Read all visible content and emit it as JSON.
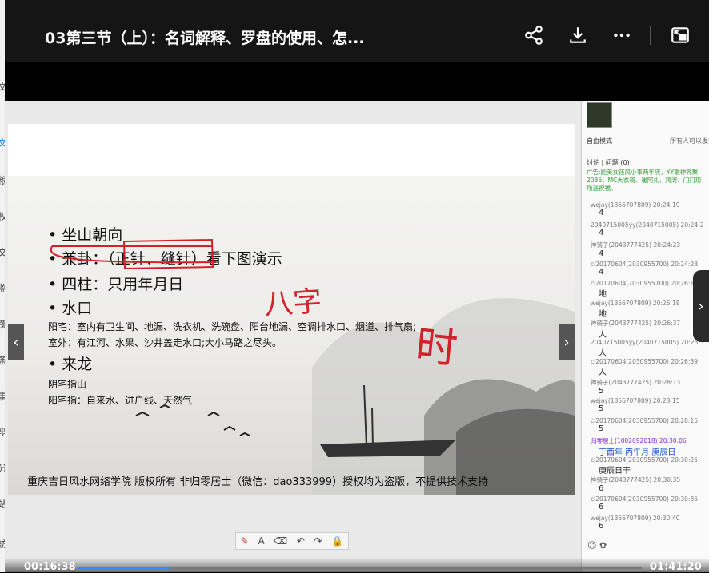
{
  "window": {
    "title": "03第三节（上）：名词解释、罗盘的使用、怎..."
  },
  "left_sidebar_chars": [
    "文",
    "粮",
    "权",
    "文",
    "监",
    "覆",
    "条",
    "事",
    "辩",
    "分",
    "站",
    "訪"
  ],
  "slide": {
    "bullets": [
      {
        "text": "• 坐山朝向"
      },
      {
        "text": "• 兼卦：（正针、缝针）看下图演示"
      },
      {
        "text": "• 四柱：只用年月日"
      },
      {
        "text": "• 水口"
      },
      {
        "text": "阳宅：室内有卫生间、地漏、洗衣机、洗碗盘、阳台地漏、空调排水口、烟道、排气扇;"
      },
      {
        "text": "室外：有江河、水果、沙井盖走水口;大小马路之尽头。"
      },
      {
        "text": "• 来龙"
      },
      {
        "text": "阴宅指山"
      },
      {
        "text": "阳宅指：自来水、进户线、天然气"
      }
    ],
    "handwriting": [
      "八字",
      "时"
    ],
    "footer": "重庆吉日风水网络学院 版权所有 非归零居士（微信：dao333999）授权均为盗版，不提供技术支持"
  },
  "toolbar": {
    "tools": [
      "✎",
      "A",
      "⌫",
      "↶",
      "↷",
      "🔒"
    ]
  },
  "player": {
    "current_time": "00:16:38",
    "total_time": "01:41:20",
    "progress": 0.164
  },
  "chat": {
    "mode": "自由模式",
    "permission": "所有人可以发言",
    "tabs": "讨论 | 问题 (0)",
    "notice": "广告:能美女孩风小事两年庆，YY歌神齐聚2086，MC大衣哥、崔阿扎、鸿涛、门门现场送祝福。",
    "messages": [
      {
        "user": "wejay(1356707809) 20:24:19",
        "text": "4"
      },
      {
        "user": "2040715005yy(2040715005) 20:24:20",
        "text": "4"
      },
      {
        "user": "神骑子(2043777425) 20:24:23",
        "text": "4"
      },
      {
        "user": "cl20170604(2030955700) 20:24:28",
        "text": "4"
      },
      {
        "user": "cl20170604(2030955700) 20:26:17",
        "text": "地"
      },
      {
        "user": "wejay(1356707809) 20:26:18",
        "text": "地"
      },
      {
        "user": "神骑子(2043777425) 20:26:37",
        "text": "人"
      },
      {
        "user": "2040715005yy(2040715005) 20:26:37",
        "text": "人"
      },
      {
        "user": "cl20170604(2030955700) 20:26:39",
        "text": "人"
      },
      {
        "user": "神骑子(2043777425) 20:28:13",
        "text": "5"
      },
      {
        "user": "wejay(1356707809) 20:28:15",
        "text": "5"
      },
      {
        "user": "cl20170604(2030955700) 20:28:15",
        "text": "5"
      },
      {
        "user": "归零居士(1002092018) 20:30:06",
        "text": "丁酉年 丙午月 庚辰日"
      },
      {
        "user": "cl20170604(2030955700) 20:30:25",
        "text": "庚辰日干"
      },
      {
        "user": "神骑子(2043777425) 20:30:35",
        "text": "6"
      },
      {
        "user": "cl20170604(2030955700) 20:30:35",
        "text": "6"
      },
      {
        "user": "wejay(1356707809) 20:30:40",
        "text": "6"
      }
    ]
  },
  "colors": {
    "accent": "#2f8bff",
    "annotation": "#d4202a",
    "notice": "#2e9e2e"
  },
  "icons": [
    "share-icon",
    "download-icon",
    "more-icon",
    "pip-icon",
    "chevron-left-icon",
    "chevron-right-icon",
    "pen-icon"
  ]
}
